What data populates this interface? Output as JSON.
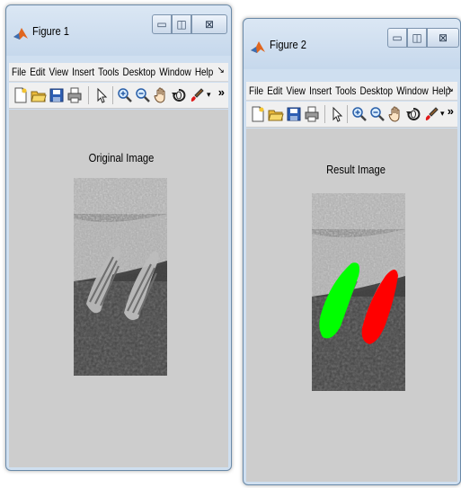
{
  "figure1": {
    "title": "Figure 1",
    "menu": [
      "File",
      "Edit",
      "View",
      "Insert",
      "Tools",
      "Desktop",
      "Window",
      "Help"
    ],
    "axes_title": "Original Image"
  },
  "figure2": {
    "title": "Figure 2",
    "menu": [
      "File",
      "Edit",
      "View",
      "Insert",
      "Tools",
      "Desktop",
      "Window",
      "Help"
    ],
    "axes_title": "Result Image"
  },
  "window_controls": {
    "minimize": "▭",
    "maximize": "◫",
    "close": "⊠"
  },
  "toolbar_overflow": "»",
  "menu_overflow": "↘",
  "colors": {
    "segment_left": "#00ff00",
    "segment_right": "#ff0000",
    "figure_bg": "#cdcdcd"
  },
  "toolbar_icons": [
    "new-figure-icon",
    "open-file-icon",
    "save-icon",
    "print-icon",
    "pointer-icon",
    "zoom-in-icon",
    "zoom-out-icon",
    "pan-hand-icon",
    "rotate-3d-icon",
    "data-cursor-brush-icon"
  ]
}
